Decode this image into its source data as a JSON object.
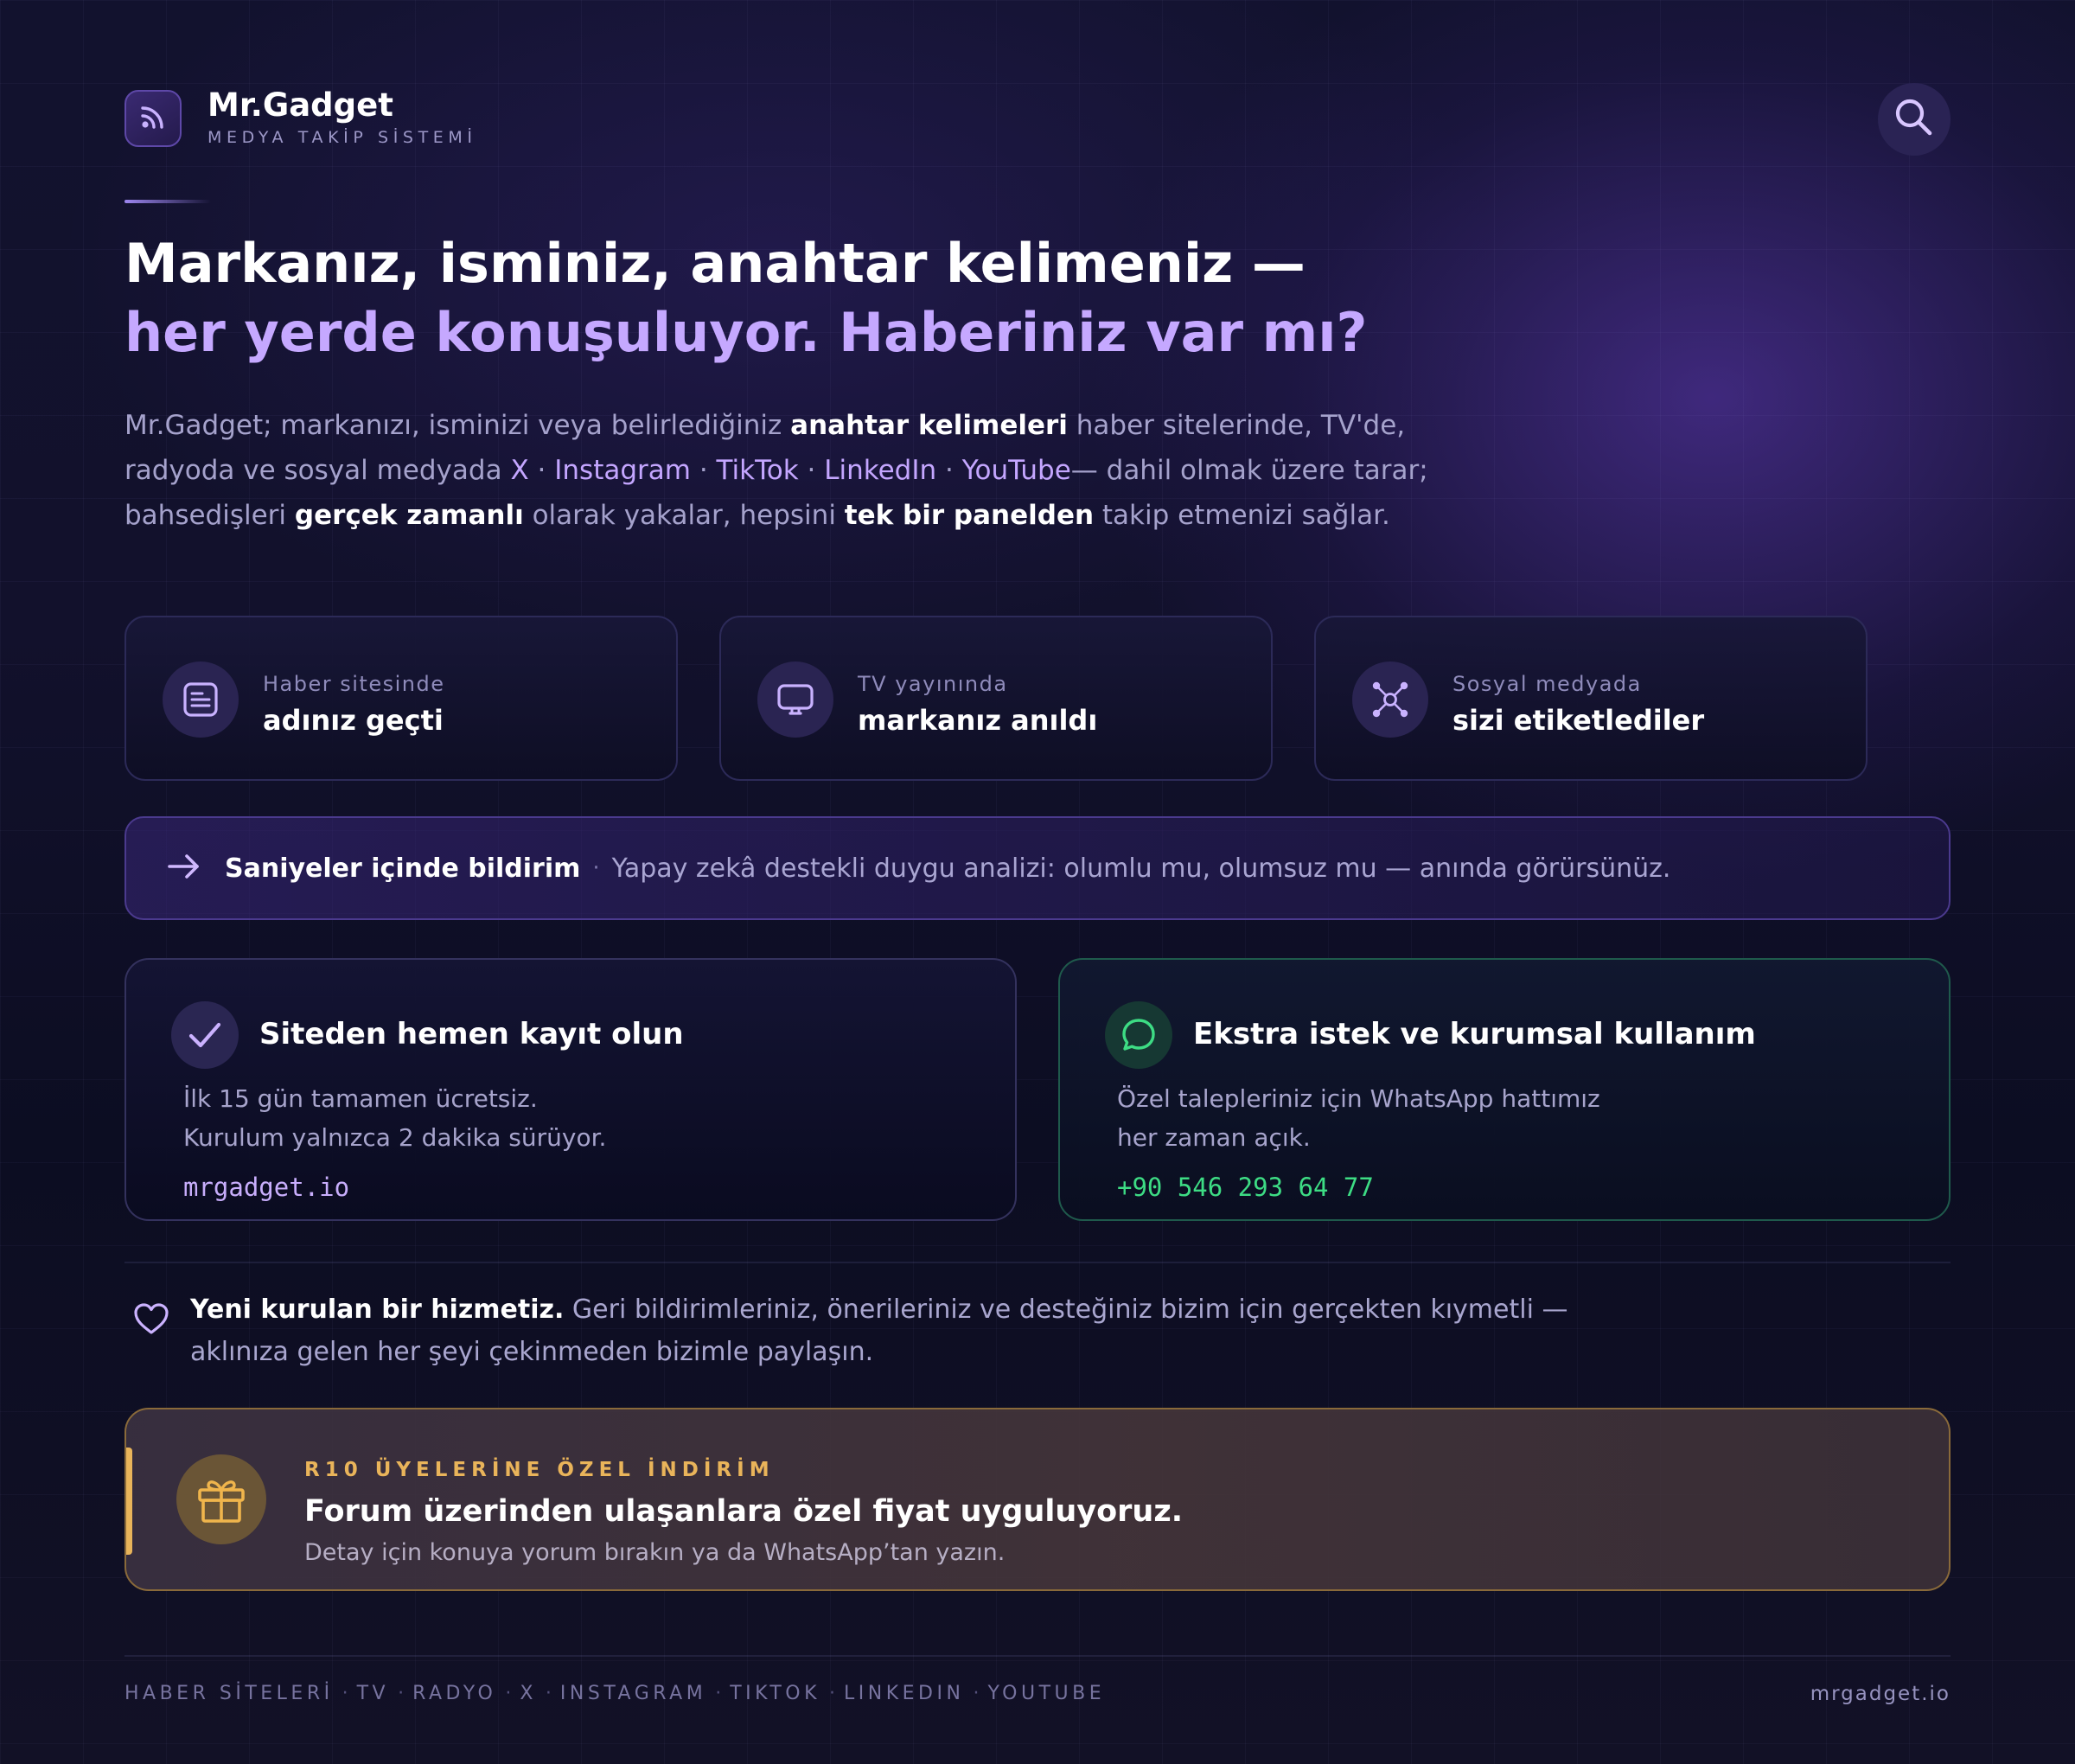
{
  "brand": {
    "name": "Mr.Gadget",
    "tagline": "MEDYA TAKİP SİSTEMİ"
  },
  "icons": {
    "logo": "rss-icon",
    "search": "search-icon"
  },
  "hero": {
    "line1": "Markanız, isminiz, anahtar kelimeniz —",
    "line2": "her yerde konuşuluyor. Haberiniz var mı?"
  },
  "intro": {
    "l1_a": "Mr.Gadget; markanızı, isminizi veya belirlediğiniz ",
    "l1_bold": "anahtar kelimeleri",
    "l1_b": " haber sitelerinde, TV'de,",
    "l2_a": "radyoda ve sosyal medyada ",
    "platforms": [
      "X",
      "Instagram",
      "TikTok",
      "LinkedIn",
      "YouTube"
    ],
    "platform_sep": " · ",
    "l2_b": "— dahil olmak üzere tarar;",
    "l3_a": "bahsedişleri ",
    "l3_bold1": "gerçek zamanlı",
    "l3_b": " olarak yakalar, hepsini ",
    "l3_bold2": "tek bir panelden",
    "l3_c": " takip etmenizi sağlar."
  },
  "mentions": [
    {
      "icon": "news-icon",
      "sub": "Haber sitesinde",
      "main": "adınız geçti"
    },
    {
      "icon": "tv-icon",
      "sub": "TV yayınında",
      "main": "markanız anıldı"
    },
    {
      "icon": "network-icon",
      "sub": "Sosyal medyada",
      "main": "sizi etiketlediler"
    }
  ],
  "notification": {
    "icon": "arrow-right-icon",
    "title": "Saniyeler içinde bildirim",
    "separator": "·",
    "text": "Yapay zekâ destekli duygu analizi: olumlu mu, olumsuz mu — anında görürsünüz."
  },
  "signup": {
    "icon": "check-icon",
    "title": "Siteden hemen kayıt olun",
    "line1": "İlk 15 gün tamamen ücretsiz.",
    "line2": "Kurulum yalnızca 2 dakika sürüyor.",
    "link": "mrgadget.io"
  },
  "whatsapp": {
    "icon": "chat-bubble-icon",
    "title": "Ekstra istek ve kurumsal kullanım",
    "line1": "Özel talepleriniz için WhatsApp hattımız",
    "line2": "her zaman açık.",
    "phone": "+90 546 293 64 77"
  },
  "feedback": {
    "icon": "heart-icon",
    "bold": "Yeni kurulan bir hizmetiz.",
    "line1": " Geri bildirimleriniz, önerileriniz ve desteğiniz bizim için gerçekten kıymetli —",
    "line2": "aklınıza gelen her şeyi çekinmeden bizimle paylaşın."
  },
  "promo": {
    "icon": "gift-icon",
    "eyebrow": "R10 ÜYELERİNE ÖZEL İNDİRİM",
    "title": "Forum üzerinden ulaşanlara özel fiyat uyguluyoruz.",
    "subtitle": "Detay için konuya yorum bırakın ya da WhatsApp’tan yazın."
  },
  "footer": {
    "channels": [
      "HABER SİTELERİ",
      "TV",
      "RADYO",
      "X",
      "INSTAGRAM",
      "TIKTOK",
      "LINKEDIN",
      "YOUTUBE"
    ],
    "separator": "·",
    "domain": "mrgadget.io"
  },
  "colors": {
    "accent": "#c5a8ff",
    "whatsapp": "#3ddc84",
    "promo": "#e9b45a"
  }
}
